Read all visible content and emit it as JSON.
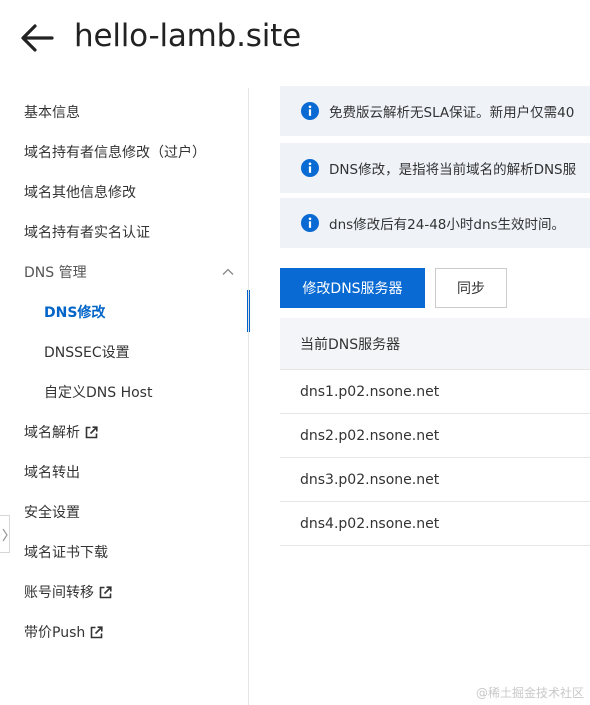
{
  "header": {
    "title": "hello-lamb.site",
    "back_icon": "arrow-left-icon"
  },
  "sidebar": {
    "items": [
      {
        "label": "基本信息"
      },
      {
        "label": "域名持有者信息修改（过户）"
      },
      {
        "label": "域名其他信息修改"
      },
      {
        "label": "域名持有者实名认证"
      },
      {
        "label": "DNS 管理",
        "expanded": true
      },
      {
        "label": "DNS修改",
        "active": true
      },
      {
        "label": "DNSSEC设置"
      },
      {
        "label": "自定义DNS Host"
      },
      {
        "label": "域名解析",
        "external": true
      },
      {
        "label": "域名转出"
      },
      {
        "label": "安全设置"
      },
      {
        "label": "域名证书下载"
      },
      {
        "label": "账号间转移",
        "external": true
      },
      {
        "label": "带价Push",
        "external": true
      }
    ]
  },
  "notices": [
    {
      "text": "免费版云解析无SLA保证。新用户仅需40",
      "icon": "info-icon"
    },
    {
      "text": "DNS修改，是指将当前域名的解析DNS服",
      "icon": "info-icon"
    },
    {
      "text": "dns修改后有24-48小时dns生效时间。",
      "icon": "info-icon"
    }
  ],
  "actions": {
    "modify_dns_label": "修改DNS服务器",
    "sync_label": "同步"
  },
  "dns_table": {
    "header": "当前DNS服务器",
    "rows": [
      "dns1.p02.nsone.net",
      "dns2.p02.nsone.net",
      "dns3.p02.nsone.net",
      "dns4.p02.nsone.net"
    ]
  },
  "watermark": "@稀土掘金技术社区",
  "colors": {
    "accent": "#0064c8",
    "primary_button": "#0a6ad3",
    "notice_bg": "#eff3f8",
    "table_header_bg": "#f3f5f8"
  }
}
